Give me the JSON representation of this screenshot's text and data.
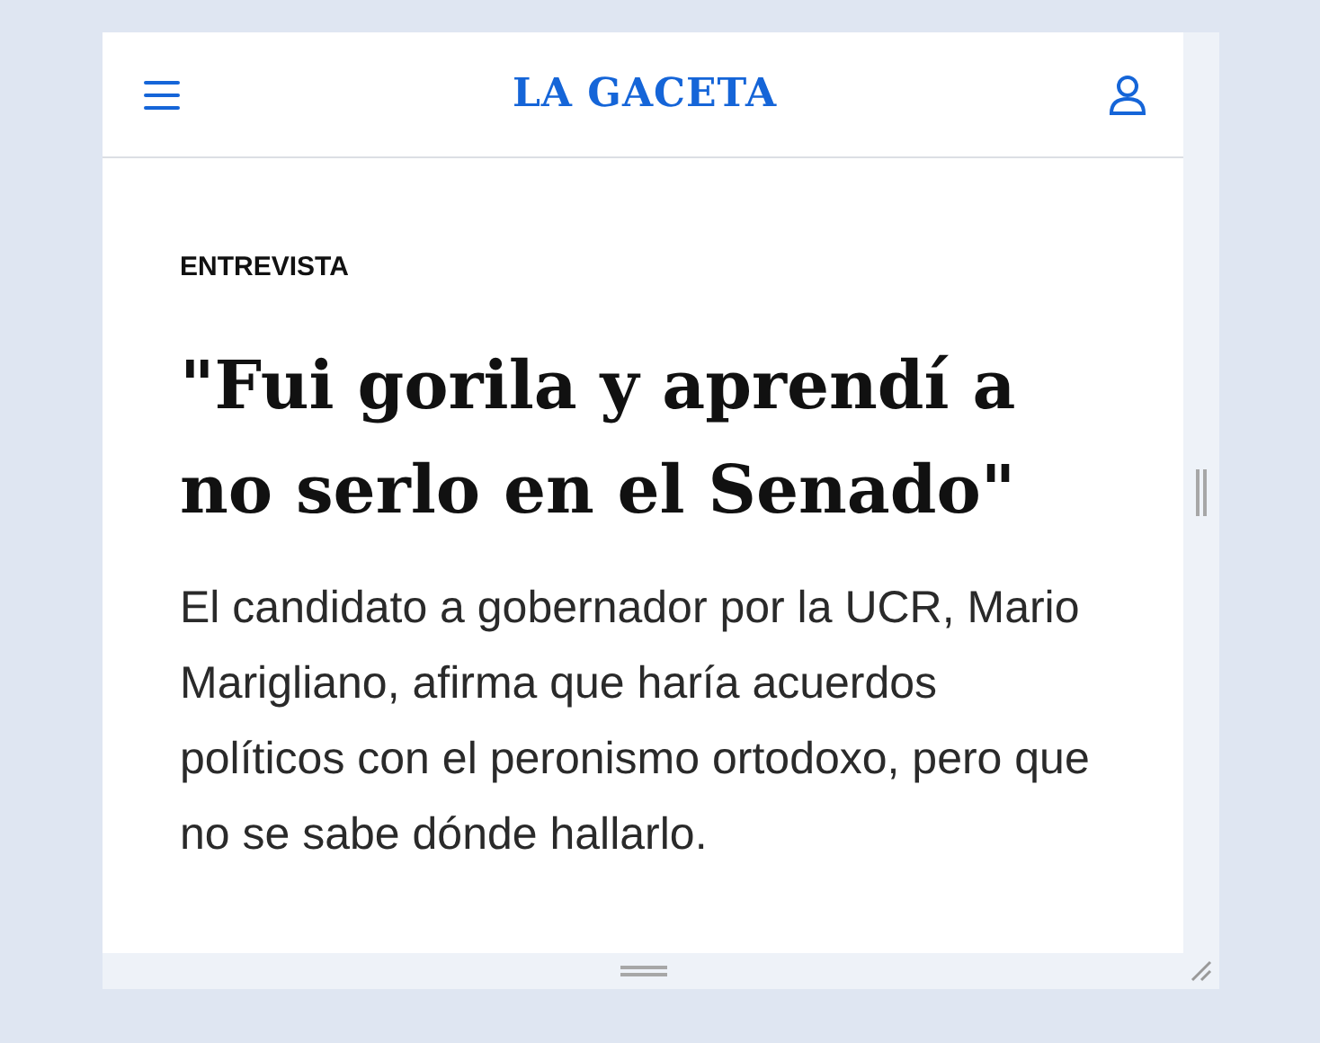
{
  "header": {
    "logo": "LA GACETA"
  },
  "article": {
    "kicker": "ENTREVISTA",
    "headline": "\"Fui gorila y aprendí a no serlo en el Senado\"",
    "lede": "El candidato a gobernador por la UCR, Mario Marigliano, afirma que haría acuerdos políticos con el peronismo ortodoxo, pero que no se sabe dónde hallarlo."
  }
}
